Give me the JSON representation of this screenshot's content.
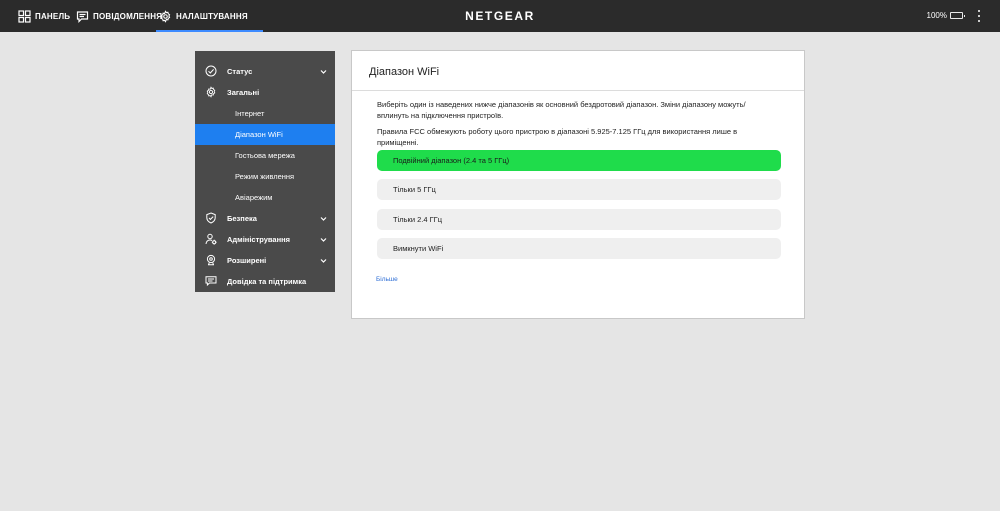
{
  "topbar": {
    "tabs": [
      {
        "label": "ПАНЕЛЬ",
        "icon": "dashboard-grid-icon"
      },
      {
        "label": "ПОВІДОМЛЕННЯ",
        "icon": "message-icon"
      },
      {
        "label": "НАЛАШТУВАННЯ",
        "icon": "gear-icon",
        "active": true
      }
    ],
    "brand": "NETGEAR",
    "battery_percent": "100%",
    "battery_level": 1.0,
    "battery_color": "#8fd13c",
    "accent": "#3d8bff"
  },
  "sidebar": {
    "items": [
      {
        "label": "Статус",
        "icon": "check-circle-icon",
        "expandable": true
      },
      {
        "label": "Загальні",
        "icon": "gear-icon",
        "expandable": false
      },
      {
        "label": "Інтернет"
      },
      {
        "label": "Діапазон WiFi",
        "selected": true
      },
      {
        "label": "Гостьова мережа"
      },
      {
        "label": "Режим живлення"
      },
      {
        "label": "Авіарежим"
      },
      {
        "label": "Безпека",
        "icon": "shield-check-icon",
        "expandable": true
      },
      {
        "label": "Адміністрування",
        "icon": "user-gear-icon",
        "expandable": true
      },
      {
        "label": "Розширені",
        "icon": "advanced-settings-icon",
        "expandable": true
      },
      {
        "label": "Довідка та підтримка",
        "icon": "help-chat-icon",
        "expandable": false
      }
    ],
    "selected_color": "#1e7ff0"
  },
  "panel": {
    "title": "Діапазон WiFi",
    "description1": "Виберіть один із наведених нижче діапазонів як основний бездротовий діапазон. Зміни діапазону можуть/вплинуть на підключення пристроїв.",
    "description2": "Правила FCC обмежують роботу цього пристрою в діапазоні 5.925-7.125 ГГц для використання лише в приміщенні.",
    "options": [
      {
        "label": "Подвійний діапазон (2.4 та 5 ГГц)",
        "selected": true
      },
      {
        "label": "Тільки 5 ГГц"
      },
      {
        "label": "Тільки 2.4 ГГц"
      },
      {
        "label": "Вимкнути WiFi"
      }
    ],
    "selected_color": "#1fdc4b",
    "more_link": "Більше"
  }
}
